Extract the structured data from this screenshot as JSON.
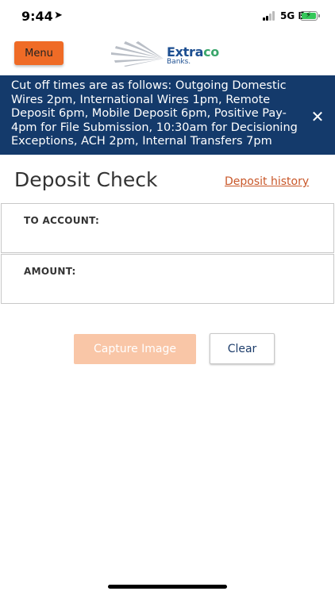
{
  "status_bar": {
    "time": "9:44",
    "network": "5G E"
  },
  "header": {
    "menu_label": "Menu",
    "logo_text_main": "Extra",
    "logo_text_accent": "co",
    "logo_subtext": "Banks."
  },
  "banner": {
    "message": "Cut off times are as follows: Outgoing Domestic Wires 2pm, International Wires 1pm, Remote Deposit 6pm, Mobile Deposit 6pm, Positive Pay- 4pm for File Submission, 10:30am for Decisioning Exceptions, ACH 2pm, Internal Transfers 7pm",
    "close_symbol": "✕"
  },
  "page": {
    "title": "Deposit Check",
    "history_link": "Deposit history"
  },
  "form": {
    "to_account_label": "TO ACCOUNT:",
    "amount_label": "AMOUNT:"
  },
  "actions": {
    "capture_label": "Capture Image",
    "clear_label": "Clear"
  },
  "colors": {
    "accent": "#ef6b26",
    "banner_bg": "#143a6b",
    "link": "#c9582a",
    "capture_disabled": "#f9c6a7"
  }
}
